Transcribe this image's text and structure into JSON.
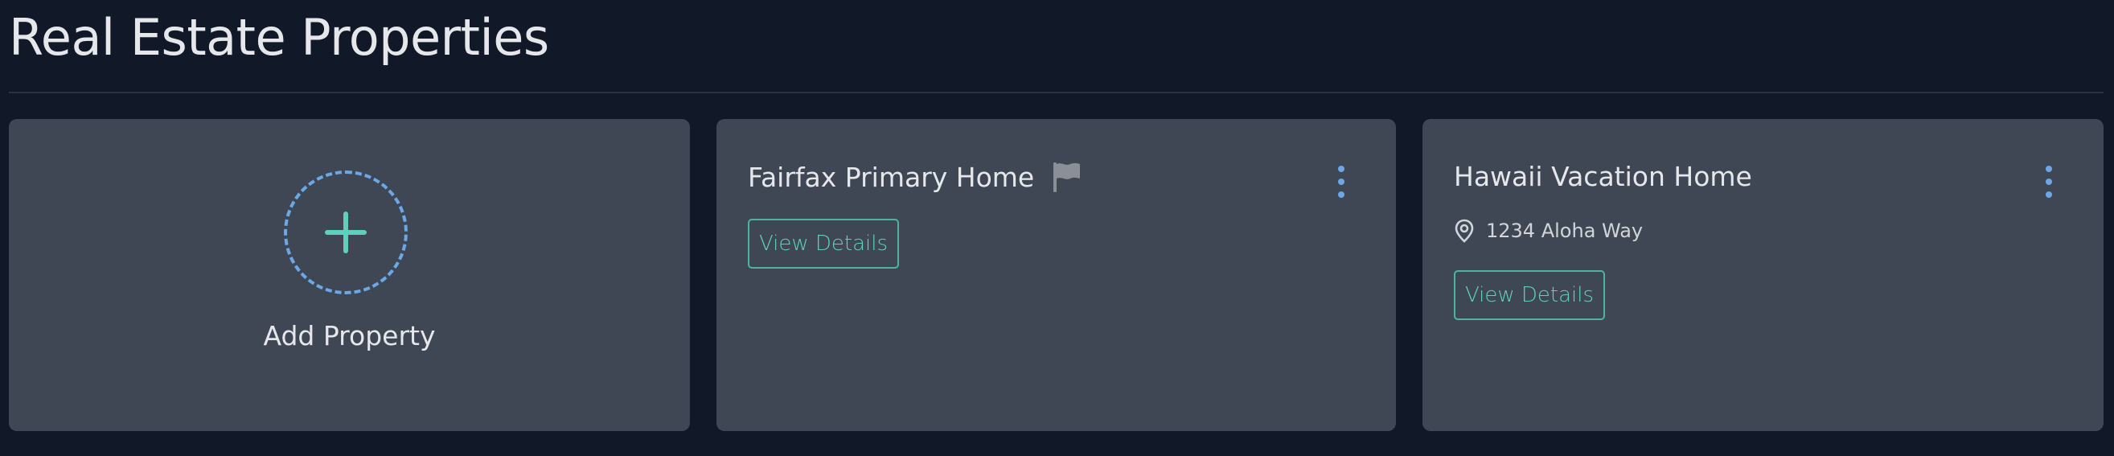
{
  "page": {
    "title": "Real Estate Properties"
  },
  "add_card": {
    "label": "Add Property",
    "icon": "plus-icon"
  },
  "properties": [
    {
      "name": "Fairfax Primary Home",
      "flag_icon": "flag-icon",
      "address": "",
      "button_label": "View Details"
    },
    {
      "name": "Hawaii Vacation Home",
      "address": "1234 Aloha Way",
      "address_icon": "location-pin-icon",
      "button_label": "View Details"
    }
  ],
  "colors": {
    "background": "#111827",
    "card": "#3f4754",
    "accent_teal": "#5fd0bd",
    "accent_blue": "#6aa8e8",
    "text": "#e5e7eb"
  }
}
